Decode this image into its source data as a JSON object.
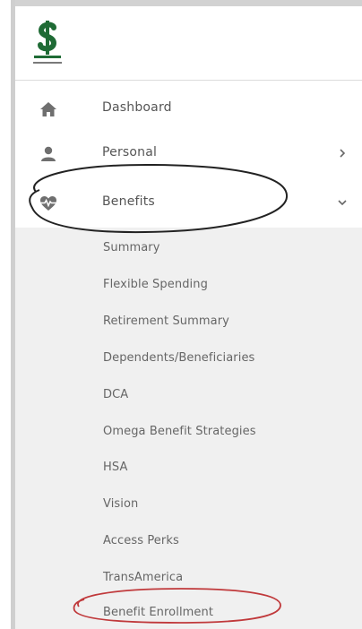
{
  "nav": {
    "items": [
      {
        "label": "Dashboard",
        "icon": "home-icon"
      },
      {
        "label": "Personal",
        "icon": "user-icon"
      },
      {
        "label": "Benefits",
        "icon": "heartbeat-icon"
      }
    ]
  },
  "submenu": {
    "items": [
      "Summary",
      "Flexible Spending",
      "Retirement Summary",
      "Dependents/Beneficiaries",
      "DCA",
      "Omega Benefit Strategies",
      "HSA",
      "Vision",
      "Access Perks",
      "TransAmerica",
      "Benefit Enrollment"
    ]
  },
  "colors": {
    "brand_green": "#1f6b35",
    "annotation_black": "#222222",
    "annotation_red": "#c0393b",
    "submenu_bg": "#f0f0f0"
  }
}
